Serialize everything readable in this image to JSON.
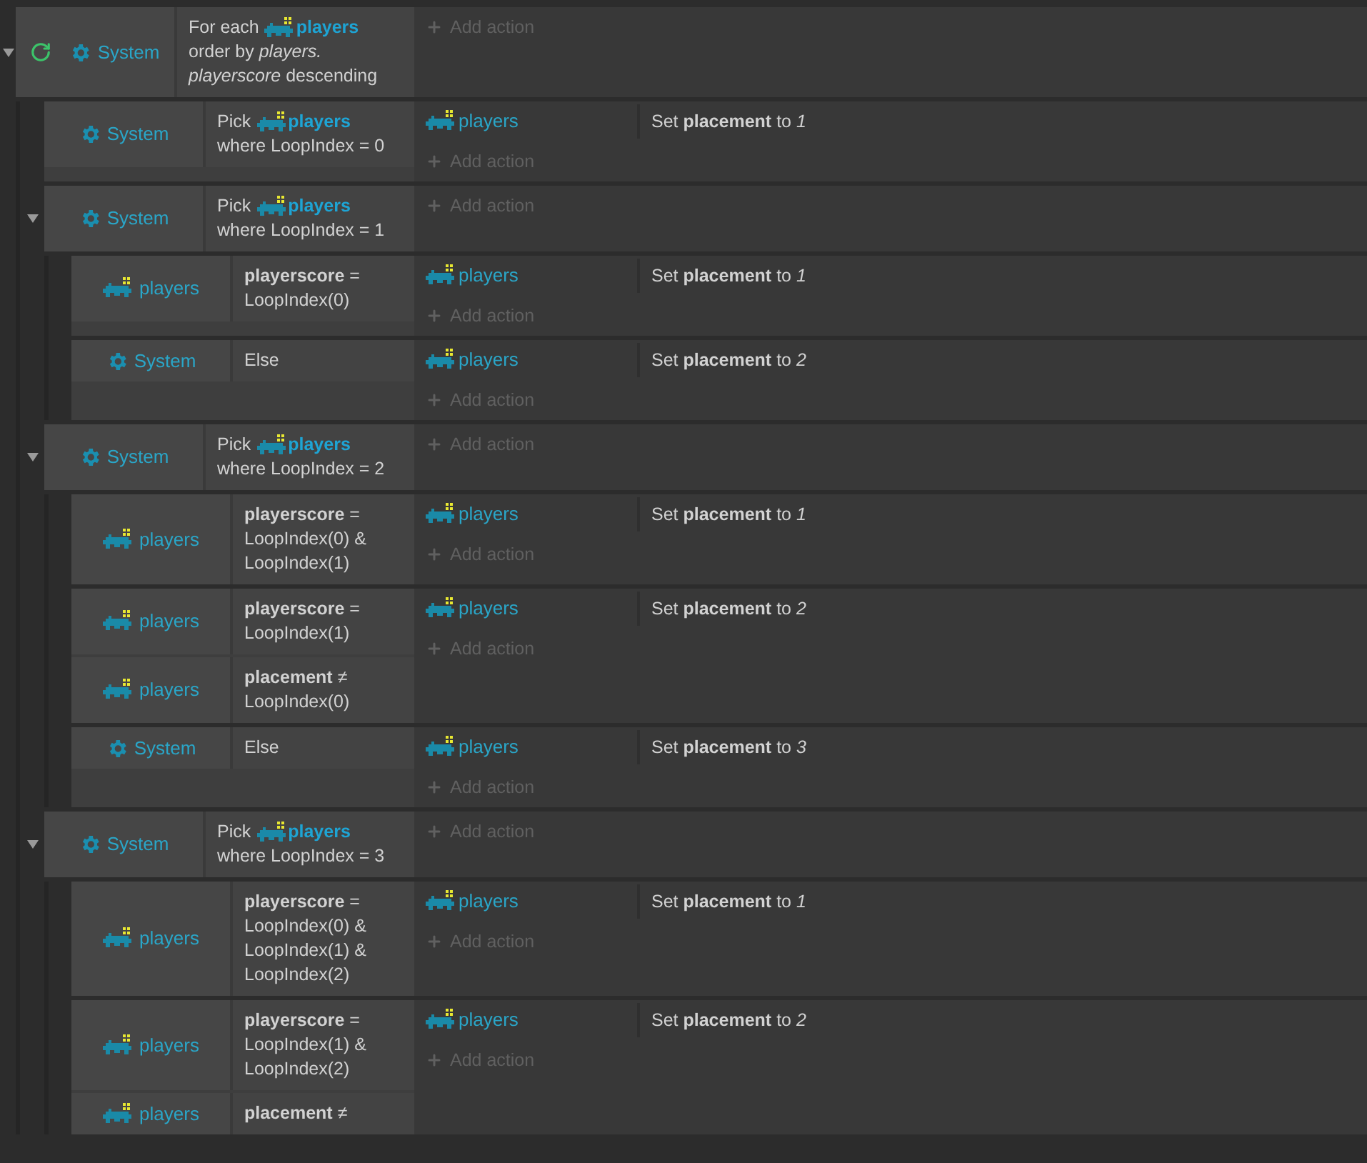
{
  "events": [
    {
      "expanded": true,
      "loop": true,
      "conditions": [
        {
          "kind": "system",
          "object": "System",
          "lines": [
            {
              "text": "For each",
              "object": "players"
            },
            {
              "text": "order by *players.*"
            },
            {
              "text": "*playerscore* descending"
            }
          ]
        }
      ],
      "add_action": "Add action",
      "children": [
        {
          "conditions": [
            {
              "kind": "system",
              "object": "System",
              "lines": [
                {
                  "text": "Pick",
                  "object": "players"
                },
                {
                  "text": "where LoopIndex = 0"
                }
              ]
            }
          ],
          "actions": [
            {
              "object": "players",
              "text": "Set **placement** to *1*"
            }
          ],
          "add_action": "Add action"
        },
        {
          "expanded": true,
          "conditions": [
            {
              "kind": "system",
              "object": "System",
              "lines": [
                {
                  "text": "Pick",
                  "object": "players"
                },
                {
                  "text": "where LoopIndex = 1"
                }
              ]
            }
          ],
          "add_action": "Add action",
          "children": [
            {
              "conditions": [
                {
                  "kind": "sprite",
                  "object": "players",
                  "lines": [
                    {
                      "text": "**playerscore** ="
                    },
                    {
                      "text": "LoopIndex(0)"
                    }
                  ]
                }
              ],
              "actions": [
                {
                  "object": "players",
                  "text": "Set **placement** to *1*"
                }
              ],
              "add_action": "Add action"
            },
            {
              "conditions": [
                {
                  "kind": "system",
                  "object": "System",
                  "lines": [
                    {
                      "text": "Else"
                    }
                  ]
                }
              ],
              "actions": [
                {
                  "object": "players",
                  "text": "Set **placement** to *2*"
                }
              ],
              "add_action": "Add action"
            }
          ]
        },
        {
          "expanded": true,
          "conditions": [
            {
              "kind": "system",
              "object": "System",
              "lines": [
                {
                  "text": "Pick",
                  "object": "players"
                },
                {
                  "text": "where LoopIndex = 2"
                }
              ]
            }
          ],
          "add_action": "Add action",
          "children": [
            {
              "conditions": [
                {
                  "kind": "sprite",
                  "object": "players",
                  "lines": [
                    {
                      "text": "**playerscore** ="
                    },
                    {
                      "text": "LoopIndex(0) &"
                    },
                    {
                      "text": "LoopIndex(1)"
                    }
                  ]
                }
              ],
              "actions": [
                {
                  "object": "players",
                  "text": "Set **placement** to *1*"
                }
              ],
              "add_action": "Add action"
            },
            {
              "conditions": [
                {
                  "kind": "sprite",
                  "object": "players",
                  "lines": [
                    {
                      "text": "**playerscore** ="
                    },
                    {
                      "text": "LoopIndex(1)"
                    }
                  ]
                },
                {
                  "kind": "sprite",
                  "object": "players",
                  "lines": [
                    {
                      "text": "**placement** ≠"
                    },
                    {
                      "text": "LoopIndex(0)"
                    }
                  ]
                }
              ],
              "actions": [
                {
                  "object": "players",
                  "text": "Set **placement** to *2*"
                }
              ],
              "add_action": "Add action"
            },
            {
              "conditions": [
                {
                  "kind": "system",
                  "object": "System",
                  "lines": [
                    {
                      "text": "Else"
                    }
                  ]
                }
              ],
              "actions": [
                {
                  "object": "players",
                  "text": "Set **placement** to *3*"
                }
              ],
              "add_action": "Add action"
            }
          ]
        },
        {
          "expanded": true,
          "conditions": [
            {
              "kind": "system",
              "object": "System",
              "lines": [
                {
                  "text": "Pick",
                  "object": "players"
                },
                {
                  "text": "where LoopIndex = 3"
                }
              ]
            }
          ],
          "add_action": "Add action",
          "children": [
            {
              "conditions": [
                {
                  "kind": "sprite",
                  "object": "players",
                  "lines": [
                    {
                      "text": "**playerscore** ="
                    },
                    {
                      "text": "LoopIndex(0) &"
                    },
                    {
                      "text": "LoopIndex(1) &"
                    },
                    {
                      "text": "LoopIndex(2)"
                    }
                  ]
                }
              ],
              "actions": [
                {
                  "object": "players",
                  "text": "Set **placement** to *1*"
                }
              ],
              "add_action": "Add action"
            },
            {
              "conditions": [
                {
                  "kind": "sprite",
                  "object": "players",
                  "lines": [
                    {
                      "text": "**playerscore** ="
                    },
                    {
                      "text": "LoopIndex(1) &"
                    },
                    {
                      "text": "LoopIndex(2)"
                    }
                  ]
                },
                {
                  "kind": "sprite",
                  "object": "players",
                  "lines": [
                    {
                      "text": "**placement** ≠"
                    }
                  ]
                }
              ],
              "actions": [
                {
                  "object": "players",
                  "text": "Set **placement** to *2*"
                }
              ],
              "add_action": "Add action"
            }
          ]
        }
      ]
    }
  ]
}
